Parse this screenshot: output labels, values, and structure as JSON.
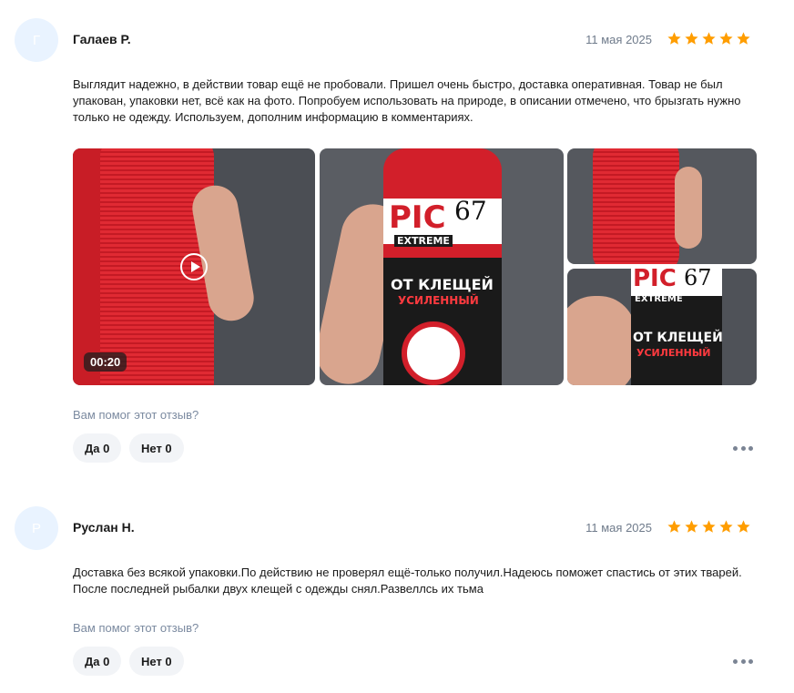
{
  "reviews": [
    {
      "avatar_letter": "Г",
      "author": "Галаев Р.",
      "date": "11 мая 2025",
      "rating": 5,
      "text": "Выглядит надежно, в действии товар ещё не пробовали. Пришел очень быстро, доставка оперативная. Товар не был упакован, упаковки нет, всё как на фото. Попробуем использовать на природе, в описании отмечено, что брызгать нужно только не одежду. Используем, дополним информацию в комментариях.",
      "video_duration": "00:20",
      "helpful_label": "Вам помог этот отзыв?",
      "yes_label": "Да 0",
      "no_label": "Нет 0",
      "product_brand": "PIC",
      "product_number": "67",
      "product_line": "EXTREME",
      "product_title": "ОТ КЛЕЩЕЙ",
      "product_subtitle": "УСИЛЕННЫЙ"
    },
    {
      "avatar_letter": "Р",
      "author": "Руслан Н.",
      "date": "11 мая 2025",
      "rating": 5,
      "text": "Доставка без всякой упаковки.По действию не проверял ещё-только получил.Надеюсь поможет спастись от этих тварей. После последней рыбалки двух клещей с одежды снял.Развеллсь их тьма",
      "helpful_label": "Вам помог этот отзыв?",
      "yes_label": "Да 0",
      "no_label": "Нет 0"
    }
  ],
  "colors": {
    "star": "#ff9d00",
    "avatar_bg": "#e9f3ff",
    "muted_text": "#7b8aa0",
    "vote_bg": "#f2f4f7"
  }
}
